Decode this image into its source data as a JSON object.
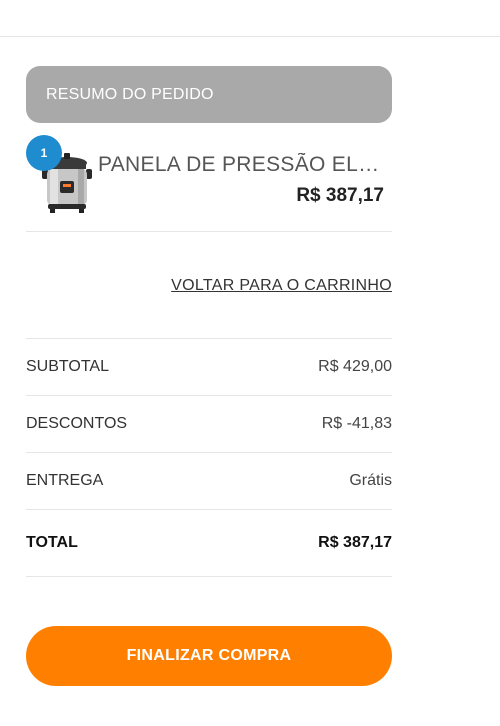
{
  "summary": {
    "title": "RESUMO DO PEDIDO"
  },
  "product": {
    "quantity": "1",
    "name": "PANELA DE PRESSÃO ELE...",
    "price": "R$ 387,17",
    "image_icon": "pressure-cooker-image"
  },
  "back_to_cart": "VOLTAR PARA O CARRINHO",
  "totals": {
    "rows": [
      {
        "label": "SUBTOTAL",
        "value": "R$ 429,00"
      },
      {
        "label": "DESCONTOS",
        "value": "R$ -41,83"
      },
      {
        "label": "ENTREGA",
        "value": "Grátis"
      }
    ],
    "total_label": "TOTAL",
    "total_value": "R$ 387,17"
  },
  "checkout_button": "FINALIZAR COMPRA",
  "colors": {
    "header_bg": "#a9a9a9",
    "badge": "#1e8ccf",
    "checkout": "#ff8000"
  }
}
